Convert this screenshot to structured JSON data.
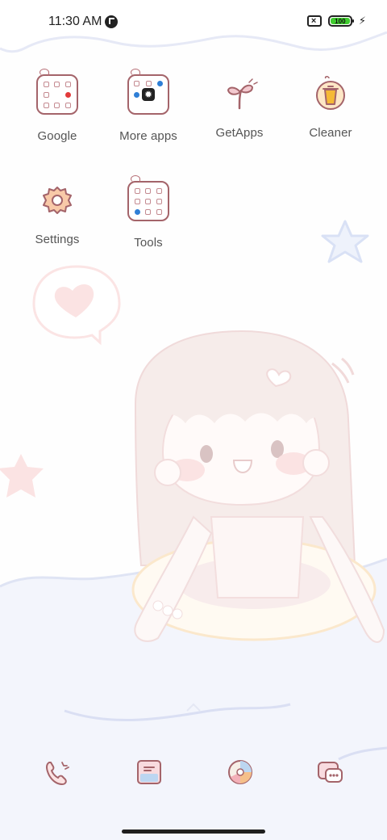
{
  "status_bar": {
    "time": "11:30 AM",
    "battery_level": "100",
    "battery_color": "#3fcc2e",
    "icons": [
      "notification-p-icon",
      "no-sim-icon",
      "battery-icon",
      "charging-bolt-icon"
    ]
  },
  "apps": [
    {
      "label": "Google",
      "icon": "google-folder-icon"
    },
    {
      "label": "More apps",
      "icon": "more-apps-folder-icon"
    },
    {
      "label": "GetApps",
      "icon": "getapps-sprout-icon"
    },
    {
      "label": "Cleaner",
      "icon": "cleaner-trash-icon"
    },
    {
      "label": "Settings",
      "icon": "settings-gear-icon"
    },
    {
      "label": "Tools",
      "icon": "tools-folder-icon"
    }
  ],
  "dock": [
    {
      "name": "phone",
      "icon": "phone-icon"
    },
    {
      "name": "notes",
      "icon": "notes-icon"
    },
    {
      "name": "browser",
      "icon": "browser-icon"
    },
    {
      "name": "messages",
      "icon": "messages-icon"
    }
  ],
  "theme": {
    "accent": "#b46a72",
    "wallpaper_tint": "#eef1fb"
  }
}
